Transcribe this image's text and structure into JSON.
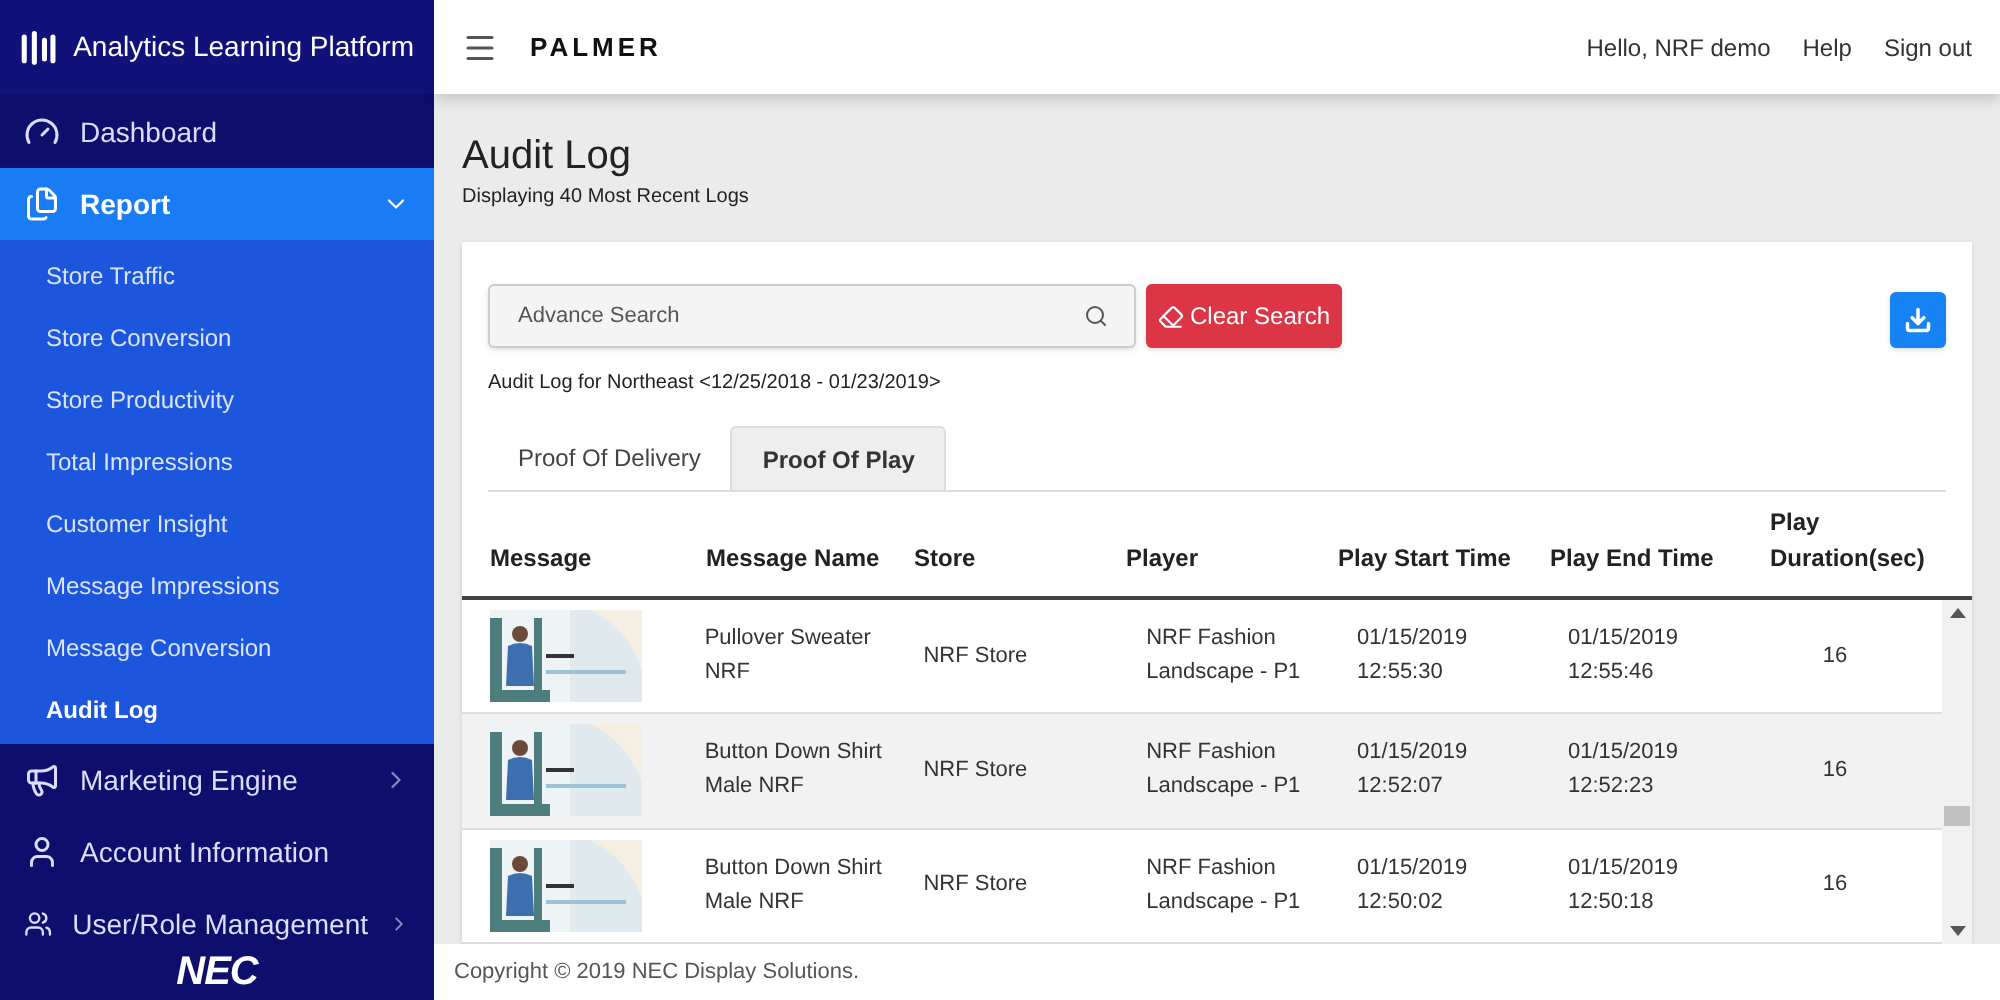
{
  "sidebar": {
    "brand": "Analytics Learning Platform",
    "items": [
      {
        "label": "Dashboard"
      },
      {
        "label": "Report",
        "expanded": true,
        "children": [
          {
            "label": "Store Traffic",
            "selected": false
          },
          {
            "label": "Store Conversion",
            "selected": false
          },
          {
            "label": "Store Productivity",
            "selected": false
          },
          {
            "label": "Total Impressions",
            "selected": false
          },
          {
            "label": "Customer Insight",
            "selected": false
          },
          {
            "label": "Message Impressions",
            "selected": false
          },
          {
            "label": "Message Conversion",
            "selected": false
          },
          {
            "label": "Audit Log",
            "selected": true
          }
        ]
      },
      {
        "label": "Marketing Engine",
        "expanded": false
      },
      {
        "label": "Account Information"
      },
      {
        "label": "User/Role Management",
        "expanded": false
      }
    ],
    "footer_logo": "NEC"
  },
  "topbar": {
    "logo": "PALMER",
    "greeting": "Hello, NRF demo",
    "links": [
      "Help",
      "Sign out"
    ]
  },
  "page": {
    "title": "Audit Log",
    "subtitle": "Displaying 40 Most Recent Logs"
  },
  "search": {
    "placeholder": "Advance Search",
    "clear_button": "Clear Search"
  },
  "caption": "Audit Log for Northeast <12/25/2018 - 01/23/2019>",
  "tabs": [
    {
      "label": "Proof Of Delivery",
      "selected": false
    },
    {
      "label": "Proof Of Play",
      "selected": true
    }
  ],
  "table": {
    "columns": [
      "Message",
      "Message Name",
      "Store",
      "Player",
      "Play Start Time",
      "Play End Time",
      "Play Duration(sec)"
    ],
    "rows": [
      {
        "name": "Pullover Sweater NRF",
        "store": "NRF Store",
        "player": "NRF Fashion Landscape - P1",
        "start": "01/15/2019 12:55:30",
        "end": "01/15/2019 12:55:46",
        "duration": "16"
      },
      {
        "name": "Button Down Shirt Male NRF",
        "store": "NRF Store",
        "player": "NRF Fashion Landscape - P1",
        "start": "01/15/2019 12:52:07",
        "end": "01/15/2019 12:52:23",
        "duration": "16"
      },
      {
        "name": "Button Down Shirt Male NRF",
        "store": "NRF Store",
        "player": "NRF Fashion Landscape - P1",
        "start": "01/15/2019 12:50:02",
        "end": "01/15/2019 12:50:18",
        "duration": "16"
      }
    ]
  },
  "footer": "Copyright © 2019 NEC Display Solutions."
}
